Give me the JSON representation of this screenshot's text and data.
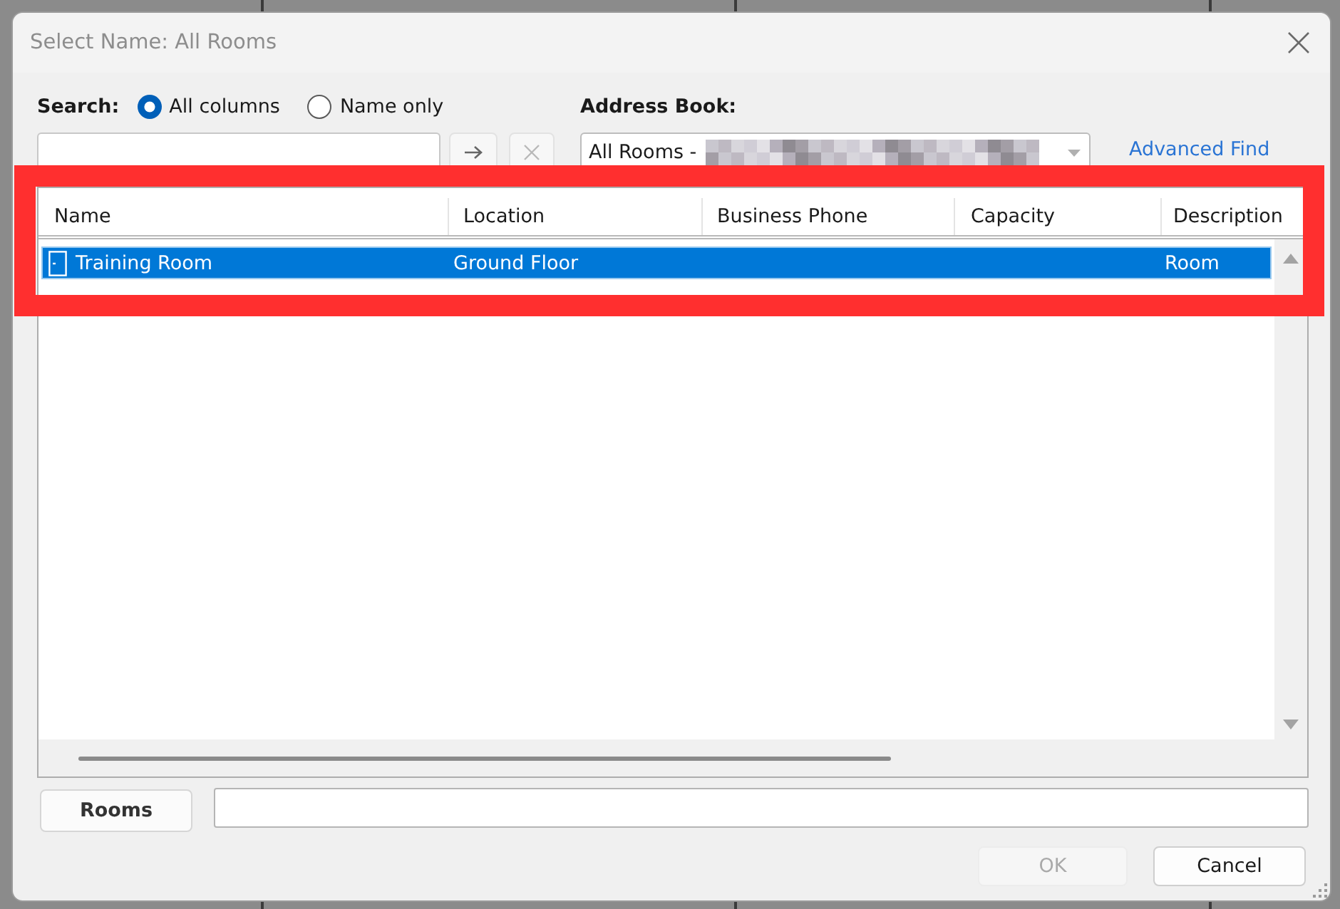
{
  "window": {
    "title": "Select Name: All Rooms"
  },
  "search": {
    "label": "Search:",
    "scope_options": [
      {
        "label": "All columns",
        "selected": true
      },
      {
        "label": "Name only",
        "selected": false
      }
    ],
    "clear_disabled": true
  },
  "address_book": {
    "label": "Address Book:",
    "value": "All Rooms -",
    "value_redacted": true
  },
  "advanced_find_link": "Advanced Find",
  "table": {
    "columns": [
      "Name",
      "Location",
      "Business Phone",
      "Capacity",
      "Description"
    ],
    "rows": [
      {
        "name": "Training Room",
        "location": "Ground Floor",
        "description": "Room",
        "selected": true
      }
    ]
  },
  "rooms_button": "Rooms",
  "buttons": [
    {
      "label": "OK",
      "disabled": true
    },
    {
      "label": "Cancel",
      "disabled": false
    }
  ]
}
